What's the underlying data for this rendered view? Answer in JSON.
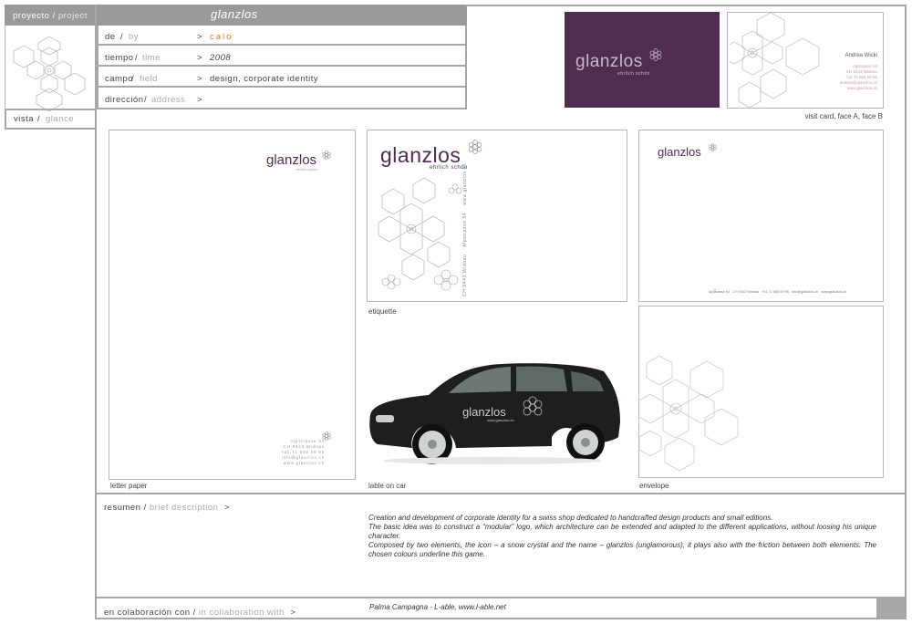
{
  "project_tab": {
    "es": "proyecto",
    "sep": " / ",
    "en": "project"
  },
  "title": "glanzlos",
  "info_rows": [
    {
      "es": "de",
      "en": "by",
      "value": "calo"
    },
    {
      "es": "tiempo",
      "en": "time",
      "value": "2008"
    },
    {
      "es": "campo",
      "en": "field",
      "value": "design, corporate identity"
    },
    {
      "es": "dirección",
      "en": "address",
      "value": ""
    }
  ],
  "arrow": ">",
  "slash": " / ",
  "vista": {
    "es": "vista",
    "en": "glance"
  },
  "resumen": {
    "es": "resumen",
    "en": "brief description"
  },
  "collab": {
    "es": "en colaboración con",
    "en": "in collaboration with",
    "value": "Palma Campagna - L-able, www.l-able.net"
  },
  "description": "Creation and development of corporate identity for a swiss shop dedicated to handcrafted design products and small editions.\nThe basic idea was to construct a “modular” logo, which architecture can be extended and adapted to the different applications, without loosing his unique character.\nComposed by two elements, the icon – a snow crystal and the name – glanzlos (unglamorous), it plays also with the friction between both elements. The chosen colours underline this game.",
  "captions": {
    "visit_card": "visit card, face A, face B",
    "letter": "letter paper",
    "etiquette": "etiquette",
    "car": "lable on car",
    "envelope": "envelope"
  },
  "brand": {
    "name": "glanzlos",
    "tagline": "ehrlich schön"
  },
  "card_b": {
    "name": "Andrea Wicki",
    "lines": [
      "Alpstrasse 54",
      "CH  9443 Widnau",
      "+41 71 665 59 96",
      "andrea@glanzlos.ch",
      "www.glanzlos.ch"
    ]
  },
  "letter_address": [
    "Alpstrasse 54",
    "CH 9443 Widnau",
    "+41 71 665 59 96",
    "info@glanzlos.ch",
    "www.glanzlos.ch"
  ],
  "etiquette_vertical": "CH 9443 Widnau    Alpstrasse 54    www.glanzlos.ch",
  "envelope_footer": "Alpstrasse 54   CH 9443 Widnau   +41 71 665 59 96   info@glanzlos.ch   www.glanzlos.ch",
  "car_text": {
    "name": "glanzlos",
    "url": "www.glanzlos.ch"
  },
  "colors": {
    "accent_orange": "#e8782a",
    "plum": "#4e2d4f",
    "grey_tab": "#9a9a9a"
  }
}
